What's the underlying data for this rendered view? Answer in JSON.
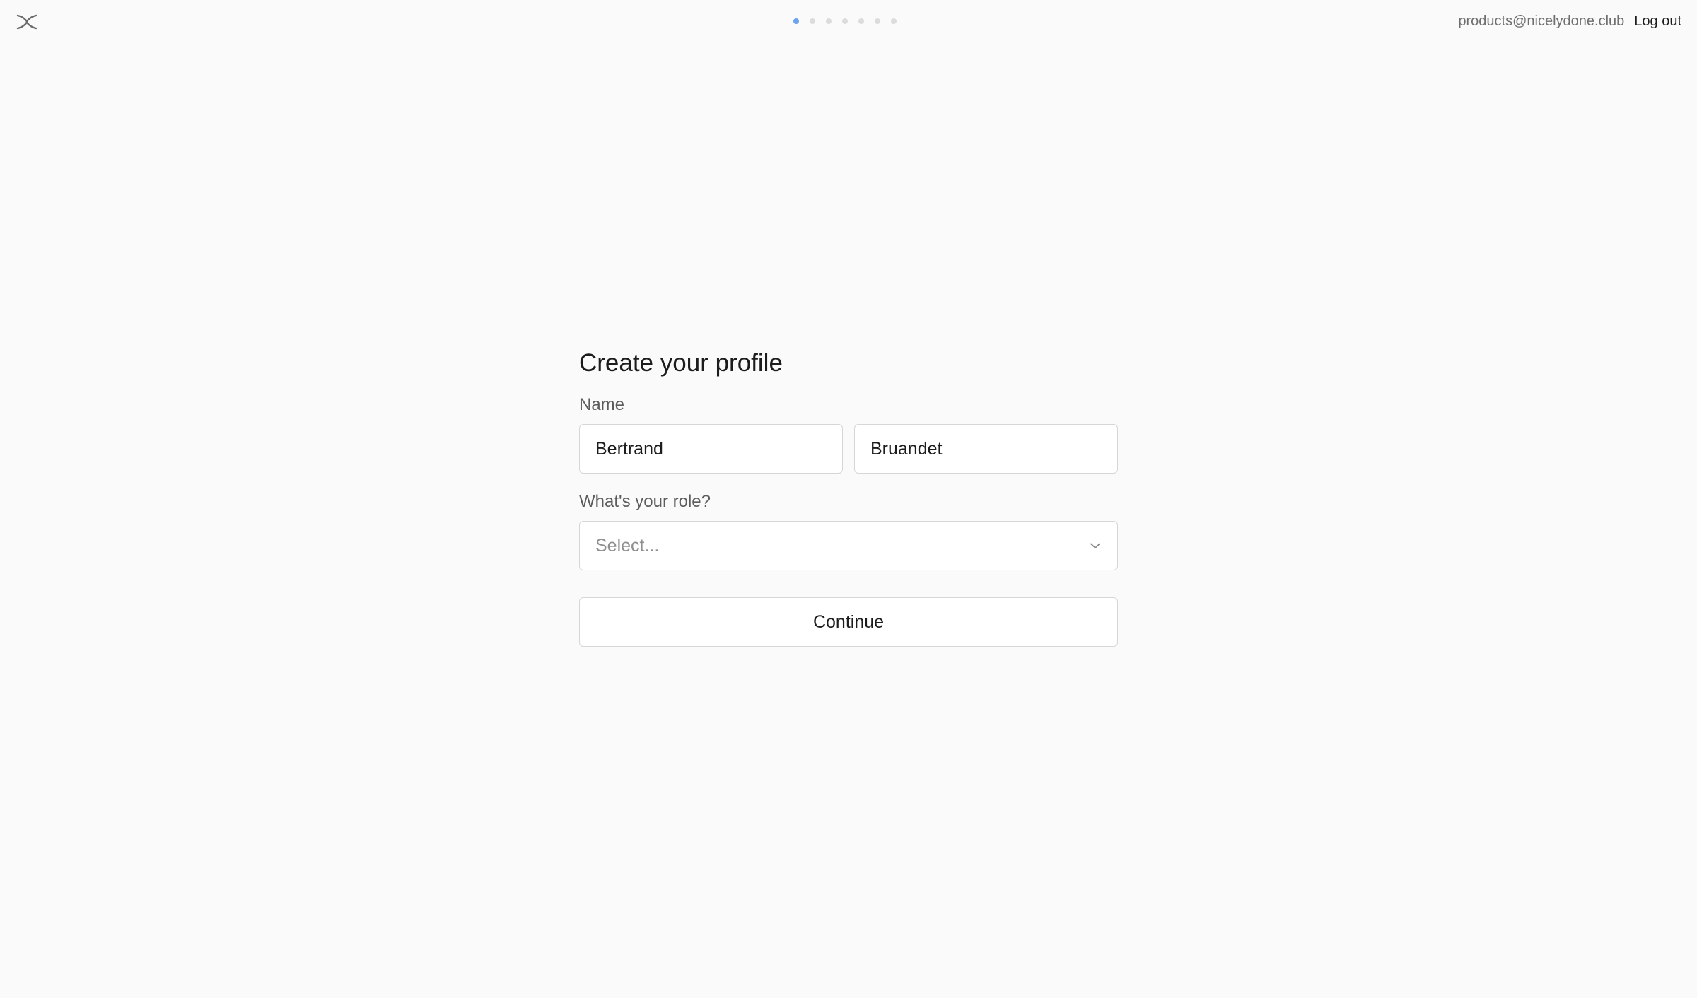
{
  "header": {
    "logo_icon": "close-x-icon",
    "steps": {
      "total": 7,
      "current": 1,
      "active_color": "#6ba4ec",
      "inactive_color": "#dcdcdc"
    },
    "account_email": "products@nicelydone.club",
    "logout_label": "Log out"
  },
  "form": {
    "title": "Create your profile",
    "name_label": "Name",
    "first_name": "Bertrand",
    "last_name": "Bruandet",
    "role_label": "What's your role?",
    "role_placeholder": "Select...",
    "role_icon": "chevron-down-icon",
    "continue_label": "Continue"
  }
}
